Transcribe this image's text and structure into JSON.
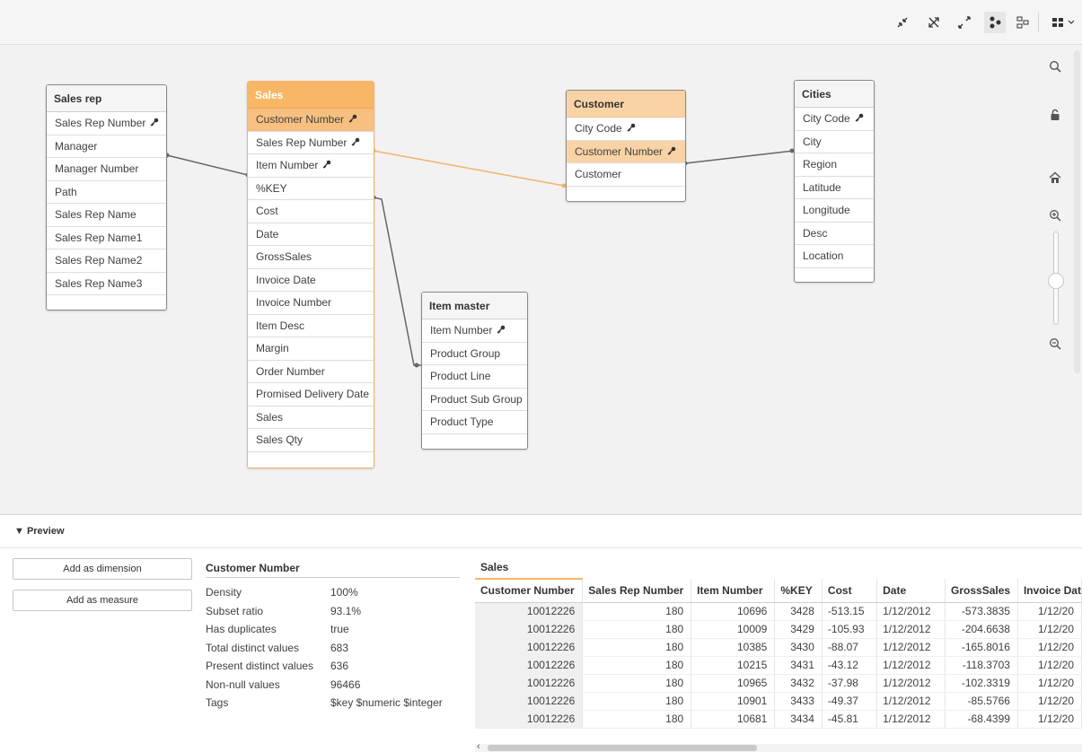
{
  "toolbar": {
    "icons": [
      "collapse-all-icon",
      "hide-links-icon",
      "expand-all-icon",
      "internal-view-icon",
      "source-view-icon",
      "layout-menu-icon"
    ]
  },
  "tables": {
    "sales_rep": {
      "title": "Sales rep",
      "fields": [
        "Sales Rep Number",
        "Manager",
        "Manager Number",
        "Path",
        "Sales Rep Name",
        "Sales Rep Name1",
        "Sales Rep Name2",
        "Sales Rep Name3"
      ],
      "keys": [
        0
      ]
    },
    "sales": {
      "title": "Sales",
      "fields": [
        "Customer Number",
        "Sales Rep Number",
        "Item Number",
        "%KEY",
        "Cost",
        "Date",
        "GrossSales",
        "Invoice Date",
        "Invoice Number",
        "Item Desc",
        "Margin",
        "Order Number",
        "Promised Delivery Date",
        "Sales",
        "Sales Qty"
      ],
      "keys": [
        0,
        1,
        2
      ]
    },
    "customer": {
      "title": "Customer",
      "fields": [
        "City Code",
        "Customer Number",
        "Customer"
      ],
      "keys": [
        0,
        1
      ]
    },
    "cities": {
      "title": "Cities",
      "fields": [
        "City Code",
        "City",
        "Region",
        "Latitude",
        "Longitude",
        "Desc",
        "Location"
      ],
      "keys": [
        0
      ]
    },
    "item_master": {
      "title": "Item master",
      "fields": [
        "Item Number",
        "Product Group",
        "Product Line",
        "Product Sub Group",
        "Product Type"
      ],
      "keys": [
        0
      ]
    }
  },
  "preview": {
    "toggle_label": "▼ Preview",
    "add_dimension_label": "Add as dimension",
    "add_measure_label": "Add as measure",
    "field_title": "Customer Number",
    "stats": [
      {
        "label": "Density",
        "value": "100%"
      },
      {
        "label": "Subset ratio",
        "value": "93.1%"
      },
      {
        "label": "Has duplicates",
        "value": "true"
      },
      {
        "label": "Total distinct values",
        "value": "683"
      },
      {
        "label": "Present distinct values",
        "value": "636"
      },
      {
        "label": "Non-null values",
        "value": "96466"
      },
      {
        "label": "Tags",
        "value": "$key $numeric $integer"
      }
    ],
    "table_title": "Sales",
    "columns": [
      "Customer Number",
      "Sales Rep Number",
      "Item Number",
      "%KEY",
      "Cost",
      "Date",
      "GrossSales",
      "Invoice Dat"
    ],
    "rows": [
      [
        "10012226",
        "180",
        "10696",
        "3428",
        "-513.15",
        "1/12/2012",
        "-573.3835",
        "1/12/20"
      ],
      [
        "10012226",
        "180",
        "10009",
        "3429",
        "-105.93",
        "1/12/2012",
        "-204.6638",
        "1/12/20"
      ],
      [
        "10012226",
        "180",
        "10385",
        "3430",
        "-88.07",
        "1/12/2012",
        "-165.8016",
        "1/12/20"
      ],
      [
        "10012226",
        "180",
        "10215",
        "3431",
        "-43.12",
        "1/12/2012",
        "-118.3703",
        "1/12/20"
      ],
      [
        "10012226",
        "180",
        "10965",
        "3432",
        "-37.98",
        "1/12/2012",
        "-102.3319",
        "1/12/20"
      ],
      [
        "10012226",
        "180",
        "10901",
        "3433",
        "-49.37",
        "1/12/2012",
        "-85.5766",
        "1/12/20"
      ],
      [
        "10012226",
        "180",
        "10681",
        "3434",
        "-45.81",
        "1/12/2012",
        "-68.4399",
        "1/12/20"
      ]
    ]
  },
  "colors": {
    "selected_header": "#f7b766",
    "associated_header": "#f9d3a5",
    "association_line": "#f4b36a",
    "link_line": "#666666"
  }
}
